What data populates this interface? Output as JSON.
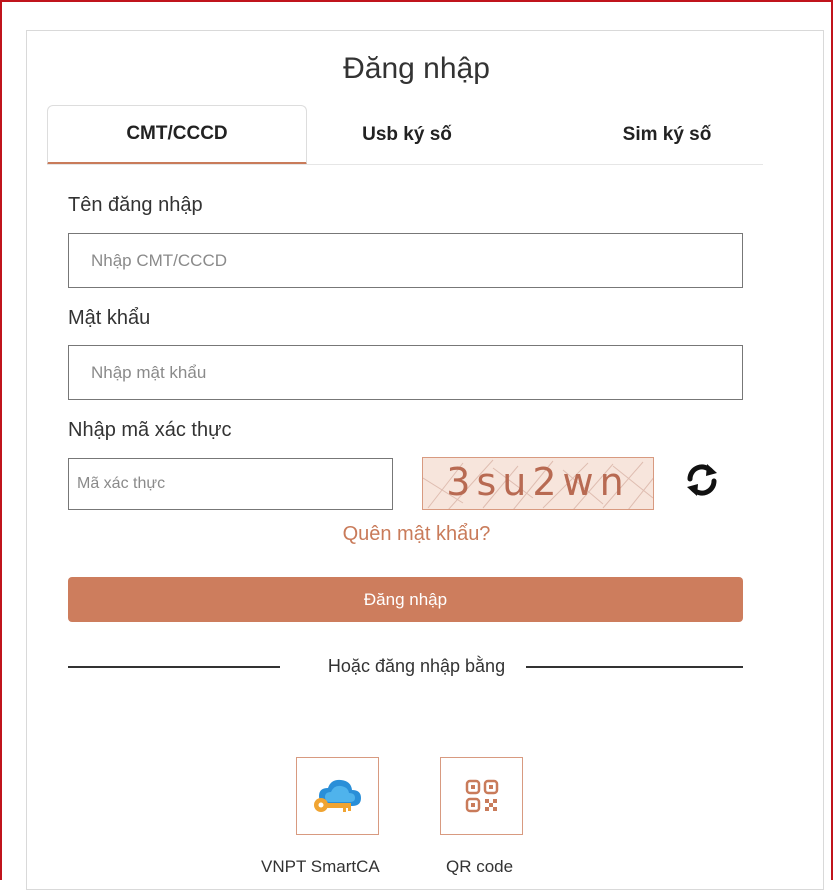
{
  "page": {
    "title": "Đăng nhập"
  },
  "tabs": [
    {
      "label": "CMT/CCCD",
      "active": true
    },
    {
      "label": "Usb ký số",
      "active": false
    },
    {
      "label": "Sim ký số",
      "active": false
    }
  ],
  "form": {
    "username_label": "Tên đăng nhập",
    "username_placeholder": "Nhập CMT/CCCD",
    "password_label": "Mật khẩu",
    "password_placeholder": "Nhập mật khẩu",
    "captcha_label": "Nhập mã xác thực",
    "captcha_placeholder": "Mã xác thực",
    "captcha_text": "3su2wn",
    "refresh_icon": "refresh-icon",
    "forgot_label": "Quên mật khẩu?",
    "submit_label": "Đăng nhập"
  },
  "alt_login": {
    "divider_label": "Hoặc đăng nhập bằng",
    "methods": [
      {
        "label": "VNPT SmartCA",
        "icon": "cloud-key-icon"
      },
      {
        "label": "QR code",
        "icon": "qr-code-icon"
      }
    ]
  },
  "colors": {
    "accent": "#cd7d5d",
    "accent_text": "#c97b5a",
    "frame_border": "#c0141c"
  }
}
